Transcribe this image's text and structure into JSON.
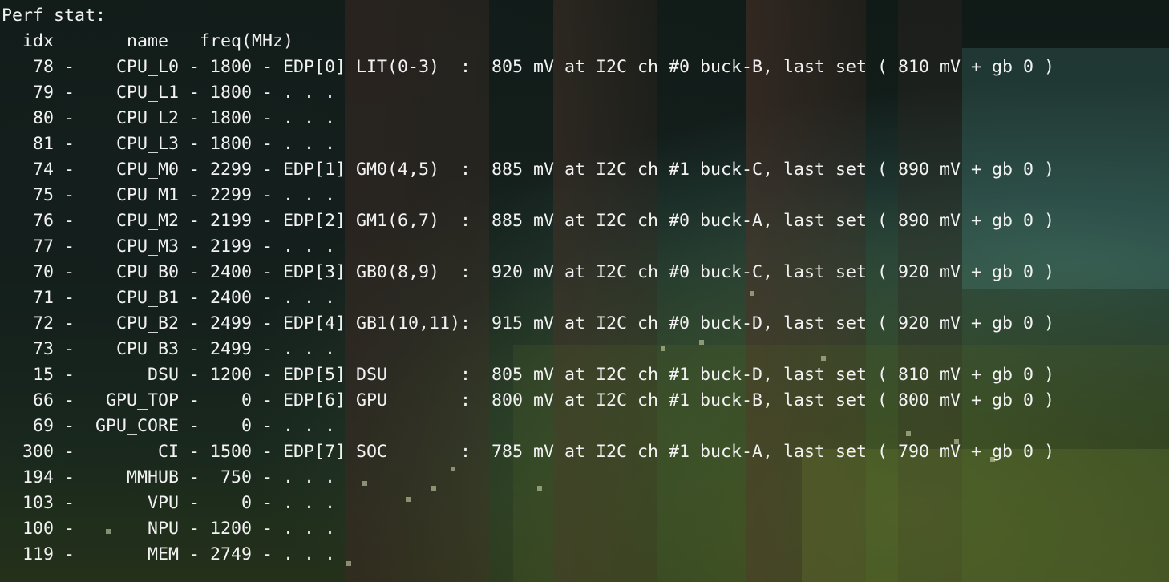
{
  "terminal": {
    "lines": [
      "Perf stat:",
      "  idx       name   freq(MHz)",
      "   78 -    CPU_L0 - 1800 - EDP[0] LIT(0-3)  :  805 mV at I2C ch #0 buck-B, last set ( 810 mV + gb 0 )",
      "   79 -    CPU_L1 - 1800 - . . .",
      "   80 -    CPU_L2 - 1800 - . . .",
      "   81 -    CPU_L3 - 1800 - . . .",
      "   74 -    CPU_M0 - 2299 - EDP[1] GM0(4,5)  :  885 mV at I2C ch #1 buck-C, last set ( 890 mV + gb 0 )",
      "   75 -    CPU_M1 - 2299 - . . .",
      "   76 -    CPU_M2 - 2199 - EDP[2] GM1(6,7)  :  885 mV at I2C ch #0 buck-A, last set ( 890 mV + gb 0 )",
      "   77 -    CPU_M3 - 2199 - . . .",
      "   70 -    CPU_B0 - 2400 - EDP[3] GB0(8,9)  :  920 mV at I2C ch #0 buck-C, last set ( 920 mV + gb 0 )",
      "   71 -    CPU_B1 - 2400 - . . .",
      "   72 -    CPU_B2 - 2499 - EDP[4] GB1(10,11):  915 mV at I2C ch #0 buck-D, last set ( 920 mV + gb 0 )",
      "   73 -    CPU_B3 - 2499 - . . .",
      "   15 -       DSU - 1200 - EDP[5] DSU       :  805 mV at I2C ch #1 buck-D, last set ( 810 mV + gb 0 )",
      "   66 -   GPU_TOP -    0 - EDP[6] GPU       :  800 mV at I2C ch #1 buck-B, last set ( 800 mV + gb 0 )",
      "   69 -  GPU_CORE -    0 - . . .",
      "  300 -        CI - 1500 - EDP[7] SOC       :  785 mV at I2C ch #1 buck-A, last set ( 790 mV + gb 0 )",
      "  194 -     MMHUB -  750 - . . .",
      "  103 -       VPU -    0 - . . .",
      "  100 -       NPU - 1200 - . . .",
      "  119 -       MEM - 2749 - . . ."
    ]
  },
  "colors": {
    "text": "#f2f2f2",
    "background": "#14201c"
  }
}
